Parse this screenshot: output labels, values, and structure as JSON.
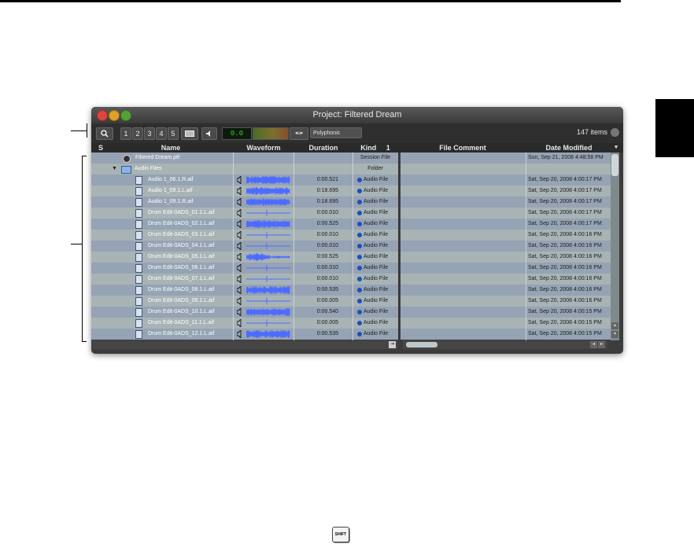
{
  "window": {
    "title": "Project: Filtered Dream"
  },
  "toolbar": {
    "search_icon": "magnifier-icon",
    "numbers": [
      "1",
      "2",
      "3",
      "4",
      "5"
    ],
    "level_display": "0.0",
    "mode": "Polyphonic",
    "item_count": "147 items"
  },
  "columns": {
    "s": "S",
    "name": "Name",
    "waveform": "Waveform",
    "duration": "Duration",
    "kind": "Kind",
    "kind_sort": "1",
    "comment": "File Comment",
    "date": "Date Modified"
  },
  "rows": [
    {
      "name": "Filtered Dream.ptf",
      "duration": "",
      "kind": "Session File",
      "date": "Sun, Sep 21, 2008 4:48:58 PM",
      "icon": "session",
      "wave": 0
    },
    {
      "name": "Audio Files",
      "duration": "",
      "kind": "Folder",
      "date": "",
      "icon": "folder",
      "wave": 0
    },
    {
      "name": "Audio 1_06.1.R.aif",
      "duration": "0:00.521",
      "kind": "Audio File",
      "date": "Sat, Sep 20, 2008 4:00:17 PM",
      "icon": "file",
      "wave": 1
    },
    {
      "name": "Audio 1_09.1.L.aif",
      "duration": "0:18.695",
      "kind": "Audio File",
      "date": "Sat, Sep 20, 2008 4:00:17 PM",
      "icon": "file",
      "wave": 1
    },
    {
      "name": "Audio 1_09.1.R.aif",
      "duration": "0:18.695",
      "kind": "Audio File",
      "date": "Sat, Sep 20, 2008 4:00:17 PM",
      "icon": "file",
      "wave": 1
    },
    {
      "name": "Drum Edit-0ADS_01.1.L.aif",
      "duration": "0:00.010",
      "kind": "Audio File",
      "date": "Sat, Sep 20, 2008 4:00:17 PM",
      "icon": "file",
      "wave": 2
    },
    {
      "name": "Drum Edit-0ADS_02.1.L.aif",
      "duration": "0:00.525",
      "kind": "Audio File",
      "date": "Sat, Sep 20, 2008 4:00:17 PM",
      "icon": "file",
      "wave": 1
    },
    {
      "name": "Drum Edit-0ADS_03.1.L.aif",
      "duration": "0:00.010",
      "kind": "Audio File",
      "date": "Sat, Sep 20, 2008 4:00:16 PM",
      "icon": "file",
      "wave": 2
    },
    {
      "name": "Drum Edit-0ADS_04.1.L.aif",
      "duration": "0:00.010",
      "kind": "Audio File",
      "date": "Sat, Sep 20, 2008 4:00:16 PM",
      "icon": "file",
      "wave": 2
    },
    {
      "name": "Drum Edit-0ADS_05.1.L.aif",
      "duration": "0:00.525",
      "kind": "Audio File",
      "date": "Sat, Sep 20, 2008 4:00:16 PM",
      "icon": "file",
      "wave": 3
    },
    {
      "name": "Drum Edit-0ADS_06.1.L.aif",
      "duration": "0:00.010",
      "kind": "Audio File",
      "date": "Sat, Sep 20, 2008 4:00:16 PM",
      "icon": "file",
      "wave": 2
    },
    {
      "name": "Drum Edit-0ADS_07.1.L.aif",
      "duration": "0:00.010",
      "kind": "Audio File",
      "date": "Sat, Sep 20, 2008 4:00:16 PM",
      "icon": "file",
      "wave": 2
    },
    {
      "name": "Drum Edit-0ADS_08.1.L.aif",
      "duration": "0:00.535",
      "kind": "Audio File",
      "date": "Sat, Sep 20, 2008 4:00:16 PM",
      "icon": "file",
      "wave": 1
    },
    {
      "name": "Drum Edit-0ADS_09.1.L.aif",
      "duration": "0:00.005",
      "kind": "Audio File",
      "date": "Sat, Sep 20, 2008 4:00:16 PM",
      "icon": "file",
      "wave": 2
    },
    {
      "name": "Drum Edit-0ADS_10.1.L.aif",
      "duration": "0:00.540",
      "kind": "Audio File",
      "date": "Sat, Sep 20, 2008 4:00:15 PM",
      "icon": "file",
      "wave": 1
    },
    {
      "name": "Drum Edit-0ADS_11.1.L.aif",
      "duration": "0:00.005",
      "kind": "Audio File",
      "date": "Sat, Sep 20, 2008 4:00:15 PM",
      "icon": "file",
      "wave": 2
    },
    {
      "name": "Drum Edit-0ADS_12.1.L.aif",
      "duration": "0:00.535",
      "kind": "Audio File",
      "date": "Sat, Sep 20, 2008 4:00:15 PM",
      "icon": "file",
      "wave": 1
    }
  ],
  "shift_key": "SHIFT",
  "colors": {
    "row_a": "#a8b3b5",
    "row_b": "#96a3b4",
    "waveform": "#4d6cff"
  }
}
